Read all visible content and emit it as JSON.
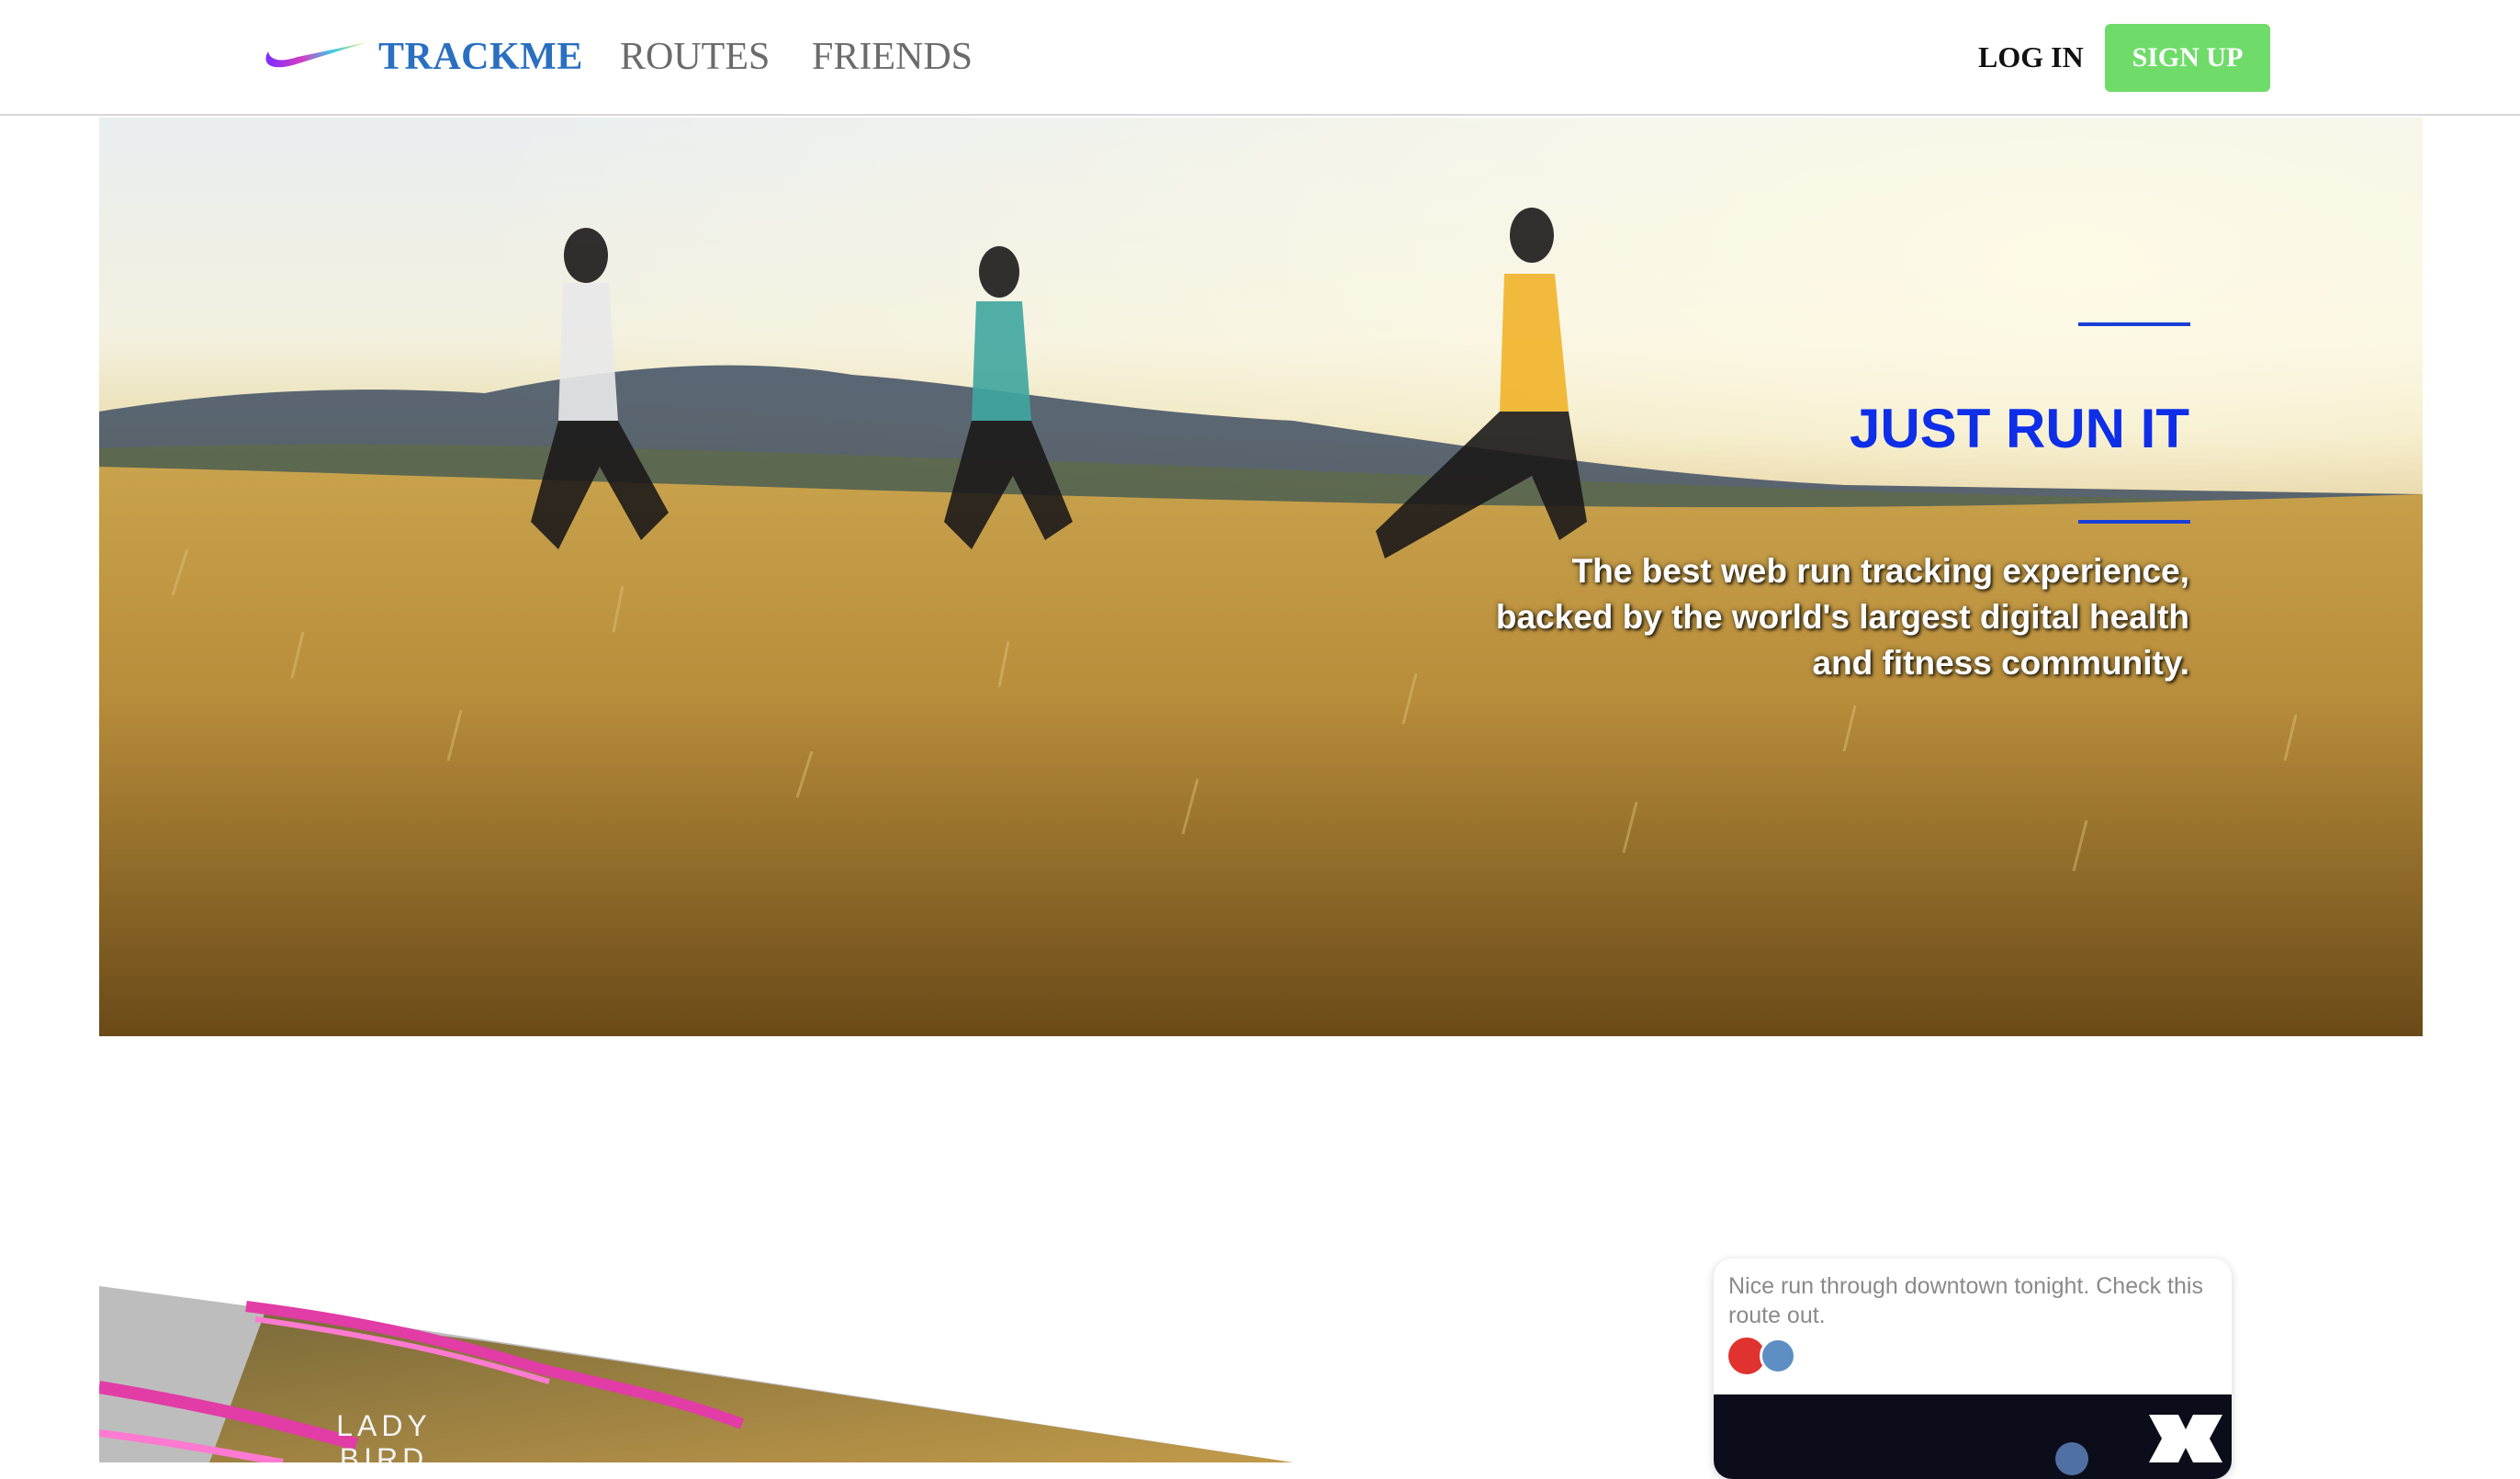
{
  "nav": {
    "brand": "TRACKME",
    "links": [
      "ROUTES",
      "FRIENDS"
    ],
    "login": "LOG IN",
    "signup": "SIGN UP"
  },
  "hero": {
    "title": "JUST RUN IT",
    "subtitle": "The best web run tracking experience, backed by the world's largest digital health and fitness community."
  },
  "map_preview": {
    "label": "LADY BIRD LAKE"
  },
  "feed_card": {
    "text": "Nice run through downtown tonight. Check this route out."
  },
  "icons": {
    "logo": "swoosh-logo-icon",
    "like": "like-icon",
    "share": "share-icon",
    "brand_mark": "brand-mark-icon"
  },
  "colors": {
    "brand_blue": "#2a6fc0",
    "signup_green": "#6fdc6a",
    "hero_title_blue": "#0f2ee8",
    "accent_line": "#1a3fd6"
  }
}
